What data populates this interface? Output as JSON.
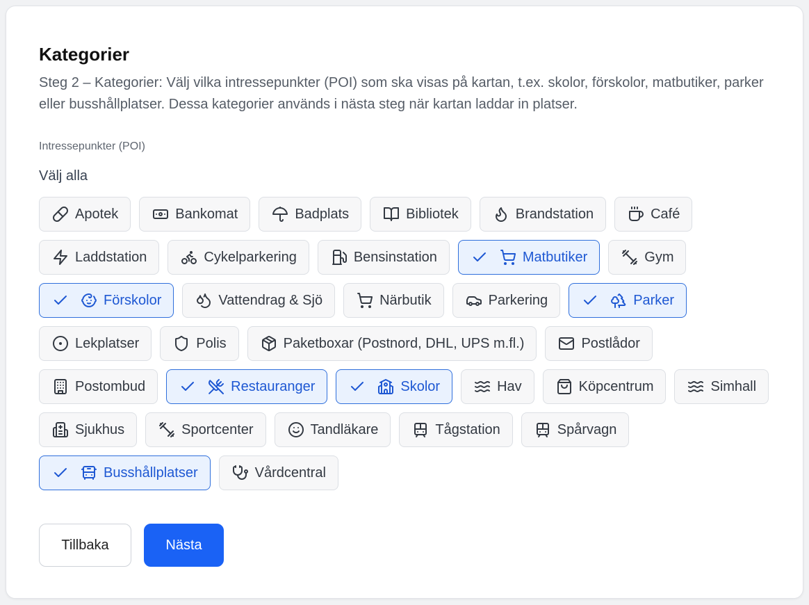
{
  "colors": {
    "accent": "#1a62f5",
    "selected_bg": "#eaf2fe",
    "selected_border": "#2f6fdc",
    "chip_bg": "#f7f7f8",
    "chip_border": "#dcdfe4"
  },
  "header": {
    "title": "Kategorier",
    "description": "Steg 2 – Kategorier: Välj vilka intressepunkter (POI) som ska visas på kartan, t.ex. skolor, förskolor, matbutiker, parker eller busshållplatser. Dessa kategorier används i nästa steg när kartan laddar in platser."
  },
  "poi": {
    "section_label": "Intressepunkter (POI)",
    "select_all_label": "Välj alla",
    "categories": [
      {
        "label": "Apotek",
        "icon": "pill-icon",
        "selected": false
      },
      {
        "label": "Bankomat",
        "icon": "banknote-icon",
        "selected": false
      },
      {
        "label": "Badplats",
        "icon": "umbrella-icon",
        "selected": false
      },
      {
        "label": "Bibliotek",
        "icon": "book-open-icon",
        "selected": false
      },
      {
        "label": "Brandstation",
        "icon": "flame-icon",
        "selected": false
      },
      {
        "label": "Café",
        "icon": "coffee-icon",
        "selected": false
      },
      {
        "label": "Laddstation",
        "icon": "zap-icon",
        "selected": false
      },
      {
        "label": "Cykelparkering",
        "icon": "bike-icon",
        "selected": false
      },
      {
        "label": "Bensinstation",
        "icon": "fuel-icon",
        "selected": false
      },
      {
        "label": "Matbutiker",
        "icon": "shopping-cart-icon",
        "selected": true
      },
      {
        "label": "Gym",
        "icon": "dumbbell-icon",
        "selected": false
      },
      {
        "label": "Förskolor",
        "icon": "baby-icon",
        "selected": true
      },
      {
        "label": "Vattendrag & Sjö",
        "icon": "droplets-icon",
        "selected": false
      },
      {
        "label": "Närbutik",
        "icon": "shopping-cart-icon",
        "selected": false
      },
      {
        "label": "Parkering",
        "icon": "car-icon",
        "selected": false
      },
      {
        "label": "Parker",
        "icon": "trees-icon",
        "selected": true
      },
      {
        "label": "Lekplatser",
        "icon": "circle-dot-icon",
        "selected": false
      },
      {
        "label": "Polis",
        "icon": "shield-icon",
        "selected": false
      },
      {
        "label": "Paketboxar (Postnord, DHL, UPS m.fl.)",
        "icon": "package-icon",
        "selected": false
      },
      {
        "label": "Postlådor",
        "icon": "mail-icon",
        "selected": false
      },
      {
        "label": "Postombud",
        "icon": "building-icon",
        "selected": false
      },
      {
        "label": "Restauranger",
        "icon": "utensils-crossed-icon",
        "selected": true
      },
      {
        "label": "Skolor",
        "icon": "school-icon",
        "selected": true
      },
      {
        "label": "Hav",
        "icon": "waves-icon",
        "selected": false
      },
      {
        "label": "Köpcentrum",
        "icon": "shopping-bag-icon",
        "selected": false
      },
      {
        "label": "Simhall",
        "icon": "waves-icon",
        "selected": false
      },
      {
        "label": "Sjukhus",
        "icon": "hospital-icon",
        "selected": false
      },
      {
        "label": "Sportcenter",
        "icon": "dumbbell-icon",
        "selected": false
      },
      {
        "label": "Tandläkare",
        "icon": "smile-icon",
        "selected": false
      },
      {
        "label": "Tågstation",
        "icon": "train-icon",
        "selected": false
      },
      {
        "label": "Spårvagn",
        "icon": "tram-icon",
        "selected": false
      },
      {
        "label": "Busshållplatser",
        "icon": "bus-icon",
        "selected": true
      },
      {
        "label": "Vårdcentral",
        "icon": "stethoscope-icon",
        "selected": false
      }
    ]
  },
  "footer": {
    "back_label": "Tillbaka",
    "next_label": "Nästa"
  }
}
